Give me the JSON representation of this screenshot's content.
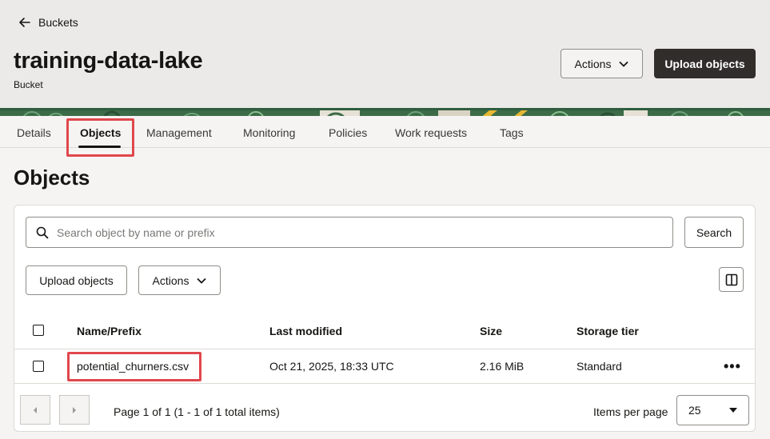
{
  "breadcrumb": {
    "back_label": "Buckets"
  },
  "header": {
    "title": "training-data-lake",
    "subtitle": "Bucket",
    "actions_label": "Actions",
    "upload_label": "Upload objects"
  },
  "tabs": [
    {
      "label": "Details"
    },
    {
      "label": "Objects",
      "active": true
    },
    {
      "label": "Management"
    },
    {
      "label": "Monitoring"
    },
    {
      "label": "Policies"
    },
    {
      "label": "Work requests"
    },
    {
      "label": "Tags"
    }
  ],
  "objects": {
    "title": "Objects",
    "search_placeholder": "Search object by name or prefix",
    "search_label": "Search",
    "upload_label": "Upload objects",
    "actions_label": "Actions"
  },
  "table": {
    "columns": [
      "Name/Prefix",
      "Last modified",
      "Size",
      "Storage tier"
    ],
    "rows": [
      {
        "name": "potential_churners.csv",
        "modified": "Oct 21, 2025, 18:33 UTC",
        "size": "2.16 MiB",
        "tier": "Standard"
      }
    ],
    "row_menu": "•••"
  },
  "pagination": {
    "info": "Page 1 of 1 (1 - 1 of 1 total items)",
    "items_per_page_label": "Items per page",
    "items_per_page": "25"
  },
  "icons": [
    "arrow-left-icon",
    "chevron-down-icon",
    "search-icon",
    "columns-icon",
    "chevron-left-icon",
    "chevron-right-icon",
    "more-icon"
  ],
  "colors": {
    "primary_dark": "#312d2a",
    "highlight": "#e0474c",
    "banner_green": "#2f5d40",
    "banner_gold": "#e7b731"
  }
}
